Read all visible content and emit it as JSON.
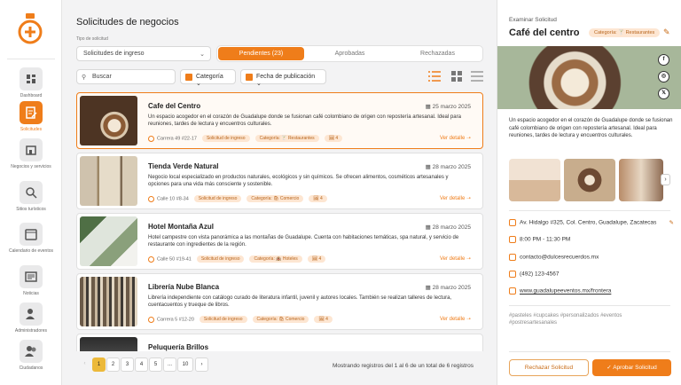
{
  "colors": {
    "accent": "#ef7d1a",
    "chip_bg": "#fde6d2",
    "page_active": "#ecb93a"
  },
  "sidebar": {
    "items": [
      {
        "label": "Dashboard",
        "icon": "dashboard-icon"
      },
      {
        "label": "Solicitudes",
        "icon": "document-edit-icon",
        "active": true
      },
      {
        "label": "Negocios y servicios",
        "icon": "store-icon"
      },
      {
        "label": "Sitios turísticos",
        "icon": "map-search-icon"
      },
      {
        "label": "Calendario de eventos",
        "icon": "calendar-icon"
      },
      {
        "label": "Noticias",
        "icon": "newspaper-icon"
      },
      {
        "label": "Administradores",
        "icon": "admin-users-icon"
      },
      {
        "label": "Ciudadanos",
        "icon": "citizens-icon"
      }
    ]
  },
  "main": {
    "title": "Solicitudes de negocios",
    "type_label": "Tipo de solicitud",
    "type_value": "Solicitudes de ingreso",
    "tabs": [
      {
        "label": "Pendientes (23)",
        "active": true
      },
      {
        "label": "Aprobadas"
      },
      {
        "label": "Rechazadas"
      }
    ],
    "search_placeholder": "Buscar",
    "filter_category": "Categoría",
    "filter_date": "Fecha de publicación",
    "more_label": "Ver detalle",
    "cards": [
      {
        "name": "Cafe del Centro",
        "date": "25 marzo 2025",
        "desc": "Un espacio acogedor en el corazón de Guadalupe donde se fusionan café colombiano de origen con repostería artesanal. Ideal para reuniones, tardes de lectura y encuentros culturales.",
        "address": "Carrera 49 #22-17",
        "type_chip": "Solicitud de ingreso",
        "category_chip": "Categoría: 🍸 Restaurantes",
        "img_chip": "🖼 4"
      },
      {
        "name": "Tienda Verde Natural",
        "date": "28 marzo 2025",
        "desc": "Negocio local especializado en productos naturales, ecológicos y sin químicos. Se ofrecen alimentos, cosméticos artesanales y opciones para una vida más consciente y sostenible.",
        "address": "Calle 10 #8-34",
        "type_chip": "Solicitud de ingreso",
        "category_chip": "Categoría: 🛍 Comercio",
        "img_chip": "🖼 4"
      },
      {
        "name": "Hotel Montaña Azul",
        "date": "28 marzo 2025",
        "desc": "Hotel campestre con vista panorámica a las montañas de Guadalupe. Cuenta con habitaciones temáticas, spa natural, y servicio de restaurante con ingredientes de la región.",
        "address": "Calle 50 #19-41",
        "type_chip": "Solicitud de ingreso",
        "category_chip": "Categoría: 🏨 Hoteles",
        "img_chip": "🖼 4"
      },
      {
        "name": "Librería Nube Blanca",
        "date": "28 marzo 2025",
        "desc": "Librería independiente con catálogo curado de literatura infantil, juvenil y autores locales. También se realizan talleres de lectura, cuentacuentos y trueque de libros.",
        "address": "Carrera 5 #12-20",
        "type_chip": "Solicitud de ingreso",
        "category_chip": "Categoría: 🛍 Comercio",
        "img_chip": "🖼 4"
      },
      {
        "name": "Peluquería Brillos",
        "date": "",
        "desc": "",
        "address": "",
        "type_chip": "",
        "category_chip": "",
        "img_chip": ""
      }
    ],
    "pagination": {
      "pages": [
        "1",
        "2",
        "3",
        "4",
        "5",
        "...",
        "10"
      ],
      "current": "1",
      "prev": "‹",
      "next": "›"
    },
    "showing": "Mostrando registros del 1 al 6 de un total de 6 registros"
  },
  "panel": {
    "sub": "Examinar Solicitud",
    "title": "Café del centro",
    "category_chip": "Categoría: 🍸 Restaurantes",
    "desc": "Un espacio acogedor en el corazón de Guadalupe donde se fusionan café colombiano de origen con repostería artesanal. Ideal para reuniones, tardes de lectura y encuentros culturales.",
    "social": [
      "f",
      "◎",
      "𝕏"
    ],
    "address": "Av. Hidalgo #325, Col. Centro, Guadalupe, Zacatecas",
    "hours": "8:00 PM - 11:30 PM",
    "email": "contacto@dulcesrecuerdos.mx",
    "phone": "(492) 123-4567",
    "web": "www.guadalupeeventos.mx/frontera",
    "tags": "#pasteles #cupcakes #personalizados #eventos #postresartesanales",
    "reject": "Rechazar Solicitud",
    "approve": "Aprobar Solicitud"
  }
}
